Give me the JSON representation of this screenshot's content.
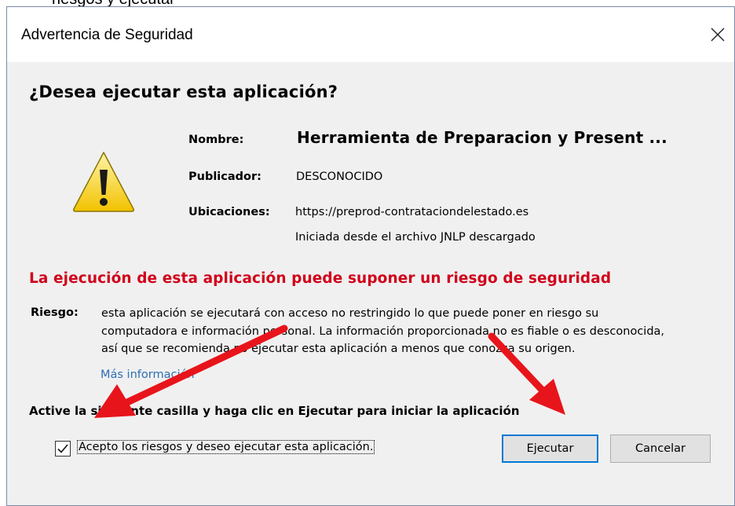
{
  "fragment": "riesgos y ejecutar",
  "window": {
    "title": "Advertencia de Seguridad"
  },
  "question": "¿Desea ejecutar esta aplicación?",
  "details": {
    "name_label": "Nombre:",
    "name_value": "Herramienta de Preparacion y Present ...",
    "publisher_label": "Publicador:",
    "publisher_value": "DESCONOCIDO",
    "locations_label": "Ubicaciones:",
    "location_1": "https://preprod-contrataciondelestado.es",
    "location_2": "Iniciada desde el archivo JNLP descargado"
  },
  "risk": {
    "heading": "La ejecución de esta aplicación puede suponer un riesgo de seguridad",
    "label": "Riesgo:",
    "line_1": "esta aplicación se ejecutará con acceso no restringido lo que puede poner en riesgo su",
    "line_2": "computadora e información personal. La información proporcionada no es fiable o es desconocida,",
    "line_3": "así que se recomienda no ejecutar esta aplicación a menos que conozca su origen.",
    "more_info": "Más información"
  },
  "instruction": "Active la siguiente casilla y haga clic en Ejecutar para iniciar la aplicación",
  "checkbox": {
    "label": "Acepto los riesgos y deseo ejecutar esta aplicación.",
    "checked": true
  },
  "buttons": {
    "run": "Ejecutar",
    "cancel": "Cancelar"
  },
  "colors": {
    "warning_text": "#d0021b",
    "arrow": "#e8141b",
    "link": "#2d6fb3",
    "focus_border": "#0078d7"
  },
  "icons": {
    "warning": "warning-triangle-icon",
    "close": "close-icon",
    "check": "check-icon"
  }
}
